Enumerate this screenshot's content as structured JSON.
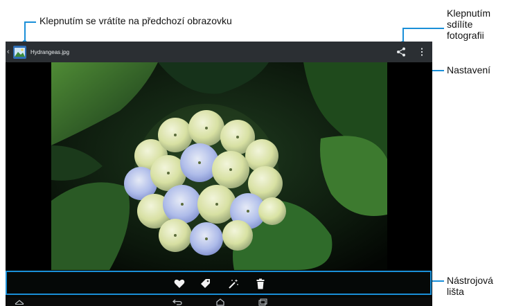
{
  "annotations": {
    "back": "Klepnutím se vrátíte na předchozí obrazovku",
    "share": "Klepnutím\nsdílíte\nfotografii",
    "settings": "Nastavení",
    "toolbar": "Nástrojová\nlišta"
  },
  "action_bar": {
    "back_glyph": "‹",
    "title": "Hydrangeas.jpg",
    "app_icon": "gallery-icon",
    "share_icon": "share-icon",
    "menu_icon": "overflow-menu-icon"
  },
  "toolbar_icons": [
    "heart-icon",
    "tag-icon",
    "magic-wand-icon",
    "trash-icon"
  ],
  "navbar_icons": [
    "home-up-icon",
    "back-icon",
    "home-icon",
    "recent-apps-icon"
  ],
  "colors": {
    "accent": "#1a8fd8",
    "action_bar": "#2b2f33",
    "background": "#000000"
  }
}
